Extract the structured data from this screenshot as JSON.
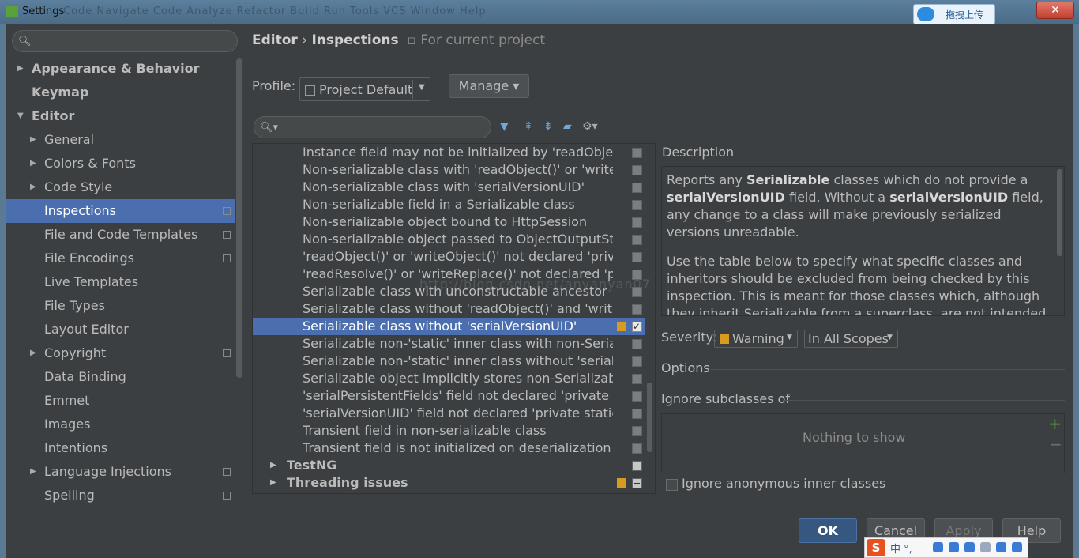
{
  "window": {
    "title": "Settings",
    "ghost_menu": "Code  Navigate  Code  Analyze  Refactor  Build  Run  Tools  VCS  Window  Help",
    "upload_button": "拖拽上传",
    "close_glyph": "✕"
  },
  "left_search": {
    "placeholder": "",
    "icon": "search-icon"
  },
  "left_tree": [
    {
      "label": "Appearance & Behavior",
      "bold": true,
      "arrow": "▶",
      "level": 0
    },
    {
      "label": "Keymap",
      "bold": true,
      "arrow": "",
      "level": 0
    },
    {
      "label": "Editor",
      "bold": true,
      "arrow": "▼",
      "level": 0
    },
    {
      "label": "General",
      "bold": false,
      "arrow": "▶",
      "level": 1
    },
    {
      "label": "Colors & Fonts",
      "bold": false,
      "arrow": "▶",
      "level": 1
    },
    {
      "label": "Code Style",
      "bold": false,
      "arrow": "▶",
      "level": 1
    },
    {
      "label": "Inspections",
      "bold": false,
      "arrow": "",
      "level": 1,
      "selected": true,
      "project_icon": true
    },
    {
      "label": "File and Code Templates",
      "bold": false,
      "arrow": "",
      "level": 1,
      "project_icon": true
    },
    {
      "label": "File Encodings",
      "bold": false,
      "arrow": "",
      "level": 1,
      "project_icon": true
    },
    {
      "label": "Live Templates",
      "bold": false,
      "arrow": "",
      "level": 1
    },
    {
      "label": "File Types",
      "bold": false,
      "arrow": "",
      "level": 1
    },
    {
      "label": "Layout Editor",
      "bold": false,
      "arrow": "",
      "level": 1
    },
    {
      "label": "Copyright",
      "bold": false,
      "arrow": "▶",
      "level": 1,
      "project_icon": true
    },
    {
      "label": "Data Binding",
      "bold": false,
      "arrow": "",
      "level": 1
    },
    {
      "label": "Emmet",
      "bold": false,
      "arrow": "",
      "level": 1
    },
    {
      "label": "Images",
      "bold": false,
      "arrow": "",
      "level": 1
    },
    {
      "label": "Intentions",
      "bold": false,
      "arrow": "",
      "level": 1
    },
    {
      "label": "Language Injections",
      "bold": false,
      "arrow": "▶",
      "level": 1,
      "project_icon": true
    },
    {
      "label": "Spelling",
      "bold": false,
      "arrow": "",
      "level": 1,
      "project_icon": true
    }
  ],
  "header": {
    "crumb_editor": "Editor",
    "crumb_sep": "›",
    "crumb_inspections": "Inspections",
    "crumb_project": "For current project"
  },
  "profile": {
    "label": "Profile:",
    "value": "Project Default",
    "manage": "Manage ▾"
  },
  "inspection_search": {
    "placeholder": ""
  },
  "toolbar_icons": [
    "filter-icon",
    "expand-all-icon",
    "collapse-all-icon",
    "reset-icon",
    "settings-icon"
  ],
  "inspections": [
    {
      "label": "Instance field may not be initialized by 'readObject()'",
      "check": "off"
    },
    {
      "label": "Non-serializable class with 'readObject()' or 'writeObject()'",
      "check": "off"
    },
    {
      "label": "Non-serializable class with 'serialVersionUID'",
      "check": "off"
    },
    {
      "label": "Non-serializable field in a Serializable class",
      "check": "off"
    },
    {
      "label": "Non-serializable object bound to HttpSession",
      "check": "off"
    },
    {
      "label": "Non-serializable object passed to ObjectOutputStream",
      "check": "off"
    },
    {
      "label": "'readObject()' or 'writeObject()' not declared 'private'",
      "check": "off"
    },
    {
      "label": "'readResolve()' or 'writeReplace()' not declared 'protected'",
      "check": "off"
    },
    {
      "label": "Serializable class with unconstructable ancestor",
      "check": "off"
    },
    {
      "label": "Serializable class without 'readObject()' and 'writeObject()'",
      "check": "off"
    },
    {
      "label": "Serializable class without 'serialVersionUID'",
      "check": "on",
      "selected": true,
      "severity": true
    },
    {
      "label": "Serializable non-'static' inner class with non-Serializable outer class",
      "check": "off"
    },
    {
      "label": "Serializable non-'static' inner class without 'serialVersionUID'",
      "check": "off"
    },
    {
      "label": "Serializable object implicitly stores non-Serializable object",
      "check": "off"
    },
    {
      "label": "'serialPersistentFields' field not declared 'private static final'",
      "check": "off"
    },
    {
      "label": "'serialVersionUID' field not declared 'private static final long'",
      "check": "off"
    },
    {
      "label": "Transient field in non-serializable class",
      "check": "off"
    },
    {
      "label": "Transient field is not initialized on deserialization",
      "check": "off"
    },
    {
      "label": "TestNG",
      "check": "mixed",
      "group": true
    },
    {
      "label": "Threading issues",
      "check": "mixed",
      "group": true,
      "severity": true
    }
  ],
  "description": {
    "label": "Description",
    "p1_a": "Reports any ",
    "p1_b": "Serializable",
    "p1_c": " classes which do not provide a ",
    "p1_d": "serialVersionUID",
    "p1_e": " field. Without a ",
    "p1_f": "serialVersionUID",
    "p1_g": " field, any change to a class will make previously serialized versions unreadable.",
    "p2": "Use the table below to specify what specific classes and inheritors should be excluded from being checked by this inspection. This is meant for those classes which, although they inherit Serializable from a superclass, are not intended for"
  },
  "severity": {
    "label": "Severity:",
    "value": "Warning",
    "scope": "In All Scopes",
    "color": "#d79c1d"
  },
  "options": {
    "label": "Options",
    "ignore_label": "Ignore subclasses of",
    "empty_text": "Nothing to show",
    "add": "+",
    "remove": "−",
    "anon_label": "Ignore anonymous inner classes"
  },
  "buttons": {
    "ok": "OK",
    "cancel": "Cancel",
    "apply": "Apply",
    "help": "Help"
  },
  "ime": {
    "logo": "S",
    "mode": "中 °,"
  },
  "watermark": "http://blog.csdn.net/anyanyan07"
}
